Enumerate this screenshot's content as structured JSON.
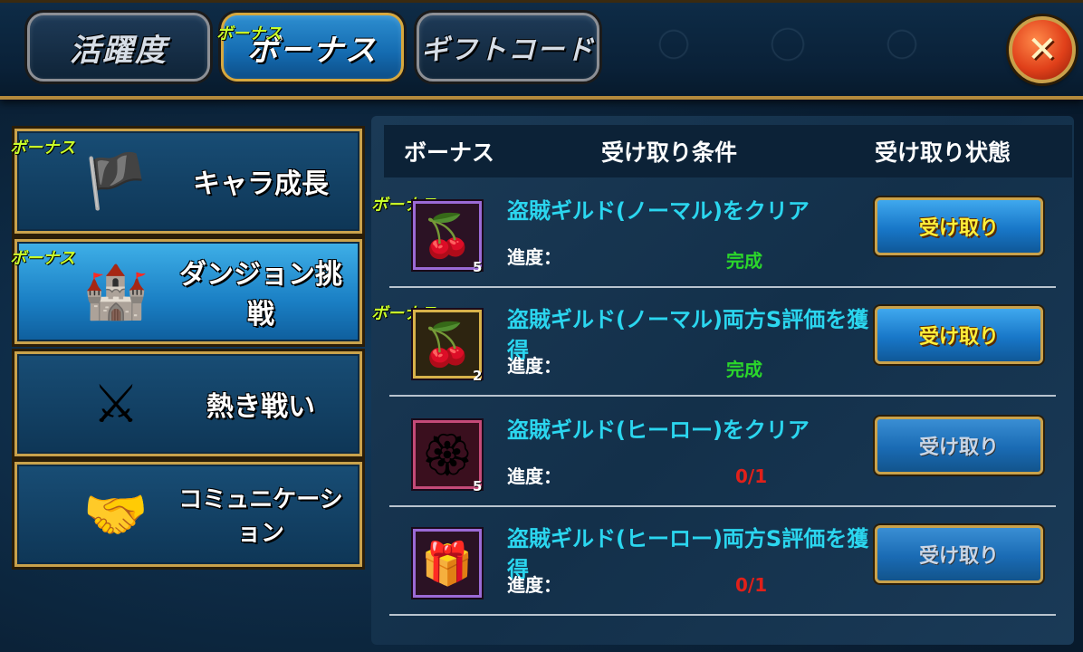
{
  "tabs": [
    {
      "label": "活躍度",
      "active": false
    },
    {
      "label": "ボーナス",
      "active": true,
      "tag": "ボーナス"
    },
    {
      "label": "ギフトコード",
      "active": false
    }
  ],
  "close_label": "✕",
  "bonus_tag": "ボーナス",
  "sidebar": {
    "items": [
      {
        "label": "キャラ成長",
        "icon": "banner-scroll-icon",
        "active": false,
        "tag": "ボーナス"
      },
      {
        "label": "ダンジョン挑戦",
        "icon": "castle-gate-icon",
        "active": true,
        "tag": "ボーナス"
      },
      {
        "label": "熱き戦い",
        "icon": "crossed-axes-icon",
        "active": false
      },
      {
        "label": "コミュニケーション",
        "icon": "handshake-icon",
        "active": false
      }
    ]
  },
  "table": {
    "headers": {
      "bonus": "ボーナス",
      "condition": "受け取り条件",
      "status": "受け取り状態"
    },
    "progress_label": "進度：",
    "rows": [
      {
        "icon": "cherries-icon",
        "count": "5",
        "tag": "ボーナス",
        "condition": "盗賊ギルド(ノーマル)をクリア",
        "progress": "完成",
        "complete": true,
        "button": "受け取り"
      },
      {
        "icon": "cherries-gold-icon",
        "count": "2",
        "tag": "ボーナス",
        "condition": "盗賊ギルド(ノーマル)両方S評価を獲得",
        "progress": "完成",
        "complete": true,
        "button": "受け取り"
      },
      {
        "icon": "emblem-icon",
        "count": "5",
        "tag": "",
        "condition": "盗賊ギルド(ヒーロー)をクリア",
        "progress": "0/1",
        "complete": false,
        "button": "受け取り"
      },
      {
        "icon": "winged-giftbox-icon",
        "count": "",
        "tag": "",
        "condition": "盗賊ギルド(ヒーロー)両方S評価を獲得",
        "progress": "0/1",
        "complete": false,
        "button": "受け取り"
      }
    ]
  }
}
